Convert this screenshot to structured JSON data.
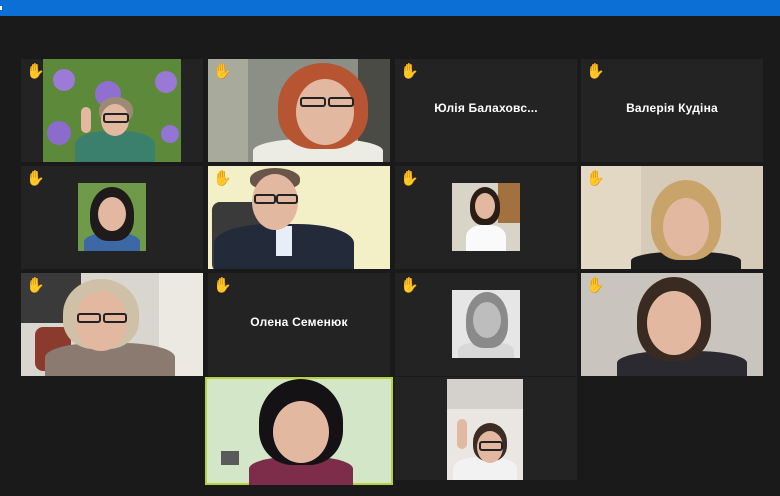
{
  "window": {
    "accent": "#0b6fd6",
    "background": "#1a1a1a"
  },
  "participants": [
    {
      "name": "",
      "hand_raised": true
    },
    {
      "name": "",
      "hand_raised": true
    },
    {
      "name": "Юлія  Балаховс...",
      "hand_raised": true
    },
    {
      "name": "Валерія Кудіна",
      "hand_raised": true
    },
    {
      "name": "",
      "hand_raised": true
    },
    {
      "name": "",
      "hand_raised": true
    },
    {
      "name": "",
      "hand_raised": true
    },
    {
      "name": "",
      "hand_raised": true
    },
    {
      "name": "",
      "hand_raised": true
    },
    {
      "name": "Олена Семенюк",
      "hand_raised": true
    },
    {
      "name": "",
      "hand_raised": true
    },
    {
      "name": "",
      "hand_raised": false
    },
    {
      "name": "",
      "hand_raised": false,
      "active_speaker": true
    },
    {
      "name": "",
      "hand_raised": false
    }
  ],
  "icons": {
    "raise_hand": "raised-hand-icon"
  },
  "colors": {
    "hand": "#f4b400",
    "active_speaker_border": "#b7d33a"
  }
}
